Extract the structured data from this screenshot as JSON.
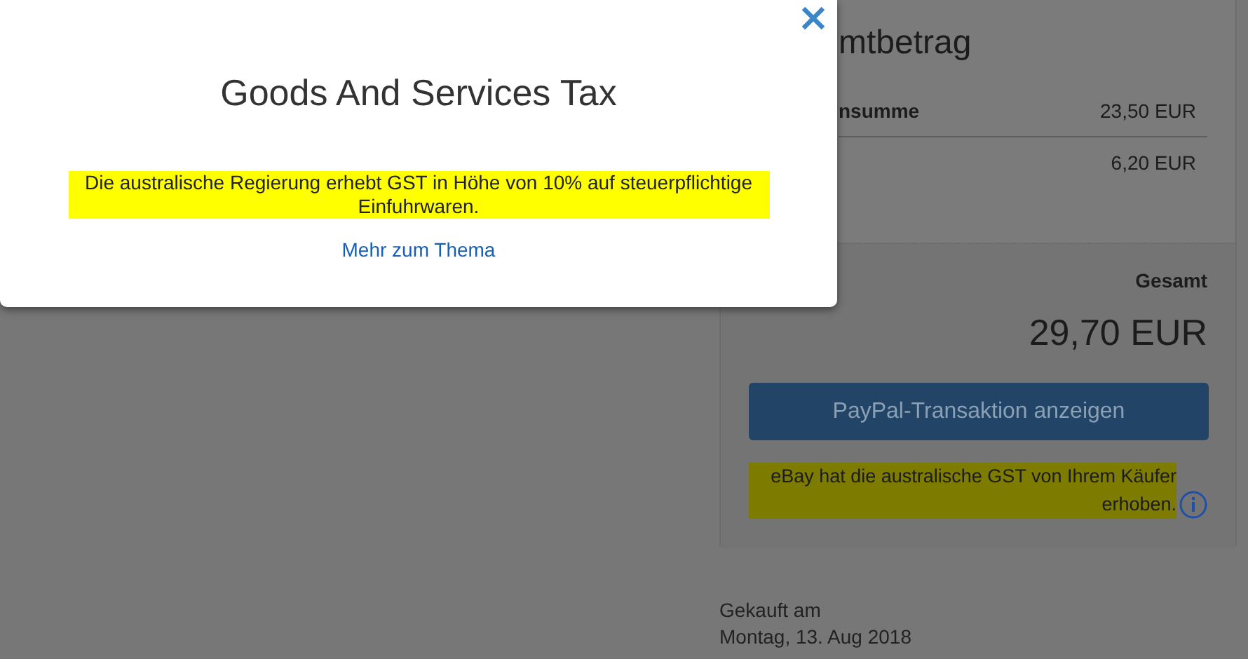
{
  "modal": {
    "title": "Goods And Services Tax",
    "body": "Die australische Regierung erhebt GST in Höhe von 10% auf steuerpflichtige Einfuhrwaren.",
    "link": "Mehr zum Thema"
  },
  "summary": {
    "heading": "mtbetrag",
    "rows": [
      {
        "label": "nsumme",
        "value": "23,50 EUR"
      },
      {
        "value": "6,20 EUR"
      }
    ],
    "total_label": "Gesamt",
    "total": "29,70 EUR",
    "button": "PayPal-Transaktion anzeigen",
    "note": "eBay hat die australische GST von Ihrem Käufer erhoben."
  },
  "purchase": {
    "label": "Gekauft am",
    "date": "Montag, 13. Aug 2018"
  }
}
